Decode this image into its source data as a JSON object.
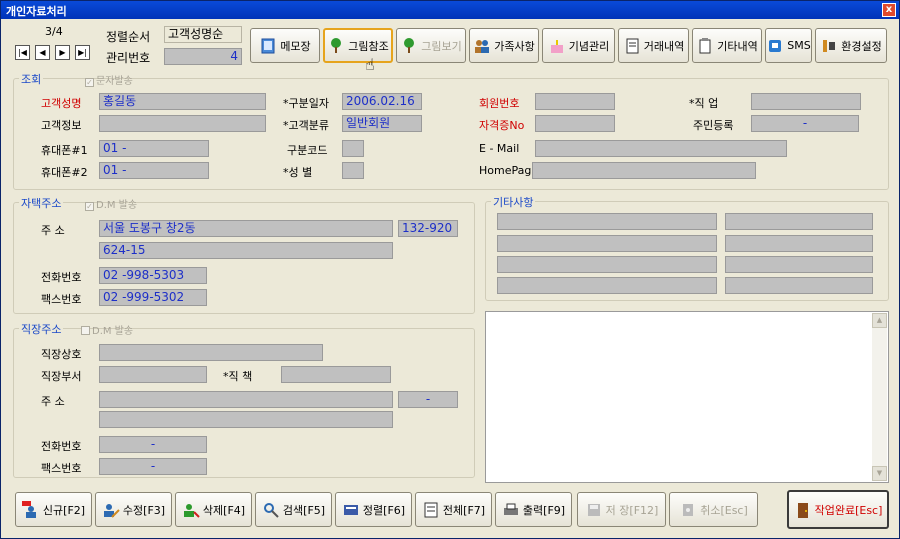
{
  "window": {
    "title": "개인자료처리",
    "close_glyph": "x"
  },
  "nav": {
    "record_counter": "3/4",
    "first": "|◀",
    "prev": "◀",
    "next": "▶",
    "last": "▶|"
  },
  "header": {
    "sort_label": "정렬순서",
    "sort_value": "고객성명순",
    "mgmt_label": "관리번호",
    "mgmt_value": "4"
  },
  "toolbar": [
    {
      "label": "메모장",
      "icon": "notepad-icon",
      "state": "normal"
    },
    {
      "label": "그림참조",
      "icon": "tree-icon",
      "state": "active"
    },
    {
      "label": "그림보기",
      "icon": "tree-icon",
      "state": "disabled"
    },
    {
      "label": "가족사항",
      "icon": "family-icon",
      "state": "normal"
    },
    {
      "label": "기념관리",
      "icon": "cake-icon",
      "state": "normal"
    },
    {
      "label": "거래내역",
      "icon": "document-icon",
      "state": "normal"
    },
    {
      "label": "기타내역",
      "icon": "note-icon",
      "state": "normal"
    },
    {
      "label": "SMS",
      "icon": "phone-icon",
      "state": "normal"
    },
    {
      "label": "환경설정",
      "icon": "tools-icon",
      "state": "normal"
    }
  ],
  "lookup": {
    "title": "조회",
    "sms_check": "문자발송",
    "name_label": "고객성명",
    "name_value": "홍길동",
    "info_label": "고객정보",
    "info_value": "",
    "mobile1_label": "휴대폰#1",
    "mobile1_value": "01  -",
    "mobile2_label": "휴대폰#2",
    "mobile2_value": "01  -",
    "date_label": "*구분일자",
    "date_value": "2006.02.16",
    "category_label": "*고객분류",
    "category_value": "일반회원",
    "code_label": "구분코드",
    "code_value": "",
    "gender_label": "*성    별",
    "gender_value": "",
    "member_label": "회원번호",
    "member_value": "",
    "cert_label": "자격증No",
    "cert_value": "",
    "email_label": "E - Mail",
    "email_value": "",
    "homepage_label": "HomePage",
    "homepage_value": "",
    "job_label": "*직    업",
    "job_value": "",
    "resident_label": "주민등록",
    "resident_value": "-"
  },
  "home": {
    "title": "자택주소",
    "dm_check": "D.M 발송",
    "addr_label": "주    소",
    "addr1": "서울 도봉구 창2동",
    "zip": "132-920",
    "addr2": "624-15",
    "phone_label": "전화번호",
    "phone_value": "02   -998-5303",
    "fax_label": "팩스번호",
    "fax_value": "02   -999-5302"
  },
  "work": {
    "title": "직장주소",
    "dm_check": "D.M 발송",
    "company_label": "직장상호",
    "company_value": "",
    "dept_label": "직장부서",
    "dept_value": "",
    "position_label": "*직    책",
    "position_value": "",
    "addr_label": "주    소",
    "addr1": "",
    "zip": "-",
    "addr2": "",
    "phone_label": "전화번호",
    "phone_value": "-",
    "fax_label": "팩스번호",
    "fax_value": "-"
  },
  "etc": {
    "title": "기타사항"
  },
  "bottom": [
    {
      "label": "신규[F2]",
      "icon": "new-user-icon",
      "state": "normal"
    },
    {
      "label": "수정[F3]",
      "icon": "edit-user-icon",
      "state": "normal"
    },
    {
      "label": "삭제[F4]",
      "icon": "delete-user-icon",
      "state": "normal"
    },
    {
      "label": "검색[F5]",
      "icon": "search-user-icon",
      "state": "normal"
    },
    {
      "label": "정렬[F6]",
      "icon": "sort-icon",
      "state": "normal"
    },
    {
      "label": "전체[F7]",
      "icon": "list-icon",
      "state": "normal"
    },
    {
      "label": "출력[F9]",
      "icon": "print-icon",
      "state": "normal"
    },
    {
      "label": "저 장[F12]",
      "icon": "save-icon",
      "state": "disabled"
    },
    {
      "label": "취소[Esc]",
      "icon": "cancel-icon",
      "state": "disabled"
    },
    {
      "label": "작업완료[Esc]",
      "icon": "exit-door-icon",
      "state": "exit"
    }
  ]
}
